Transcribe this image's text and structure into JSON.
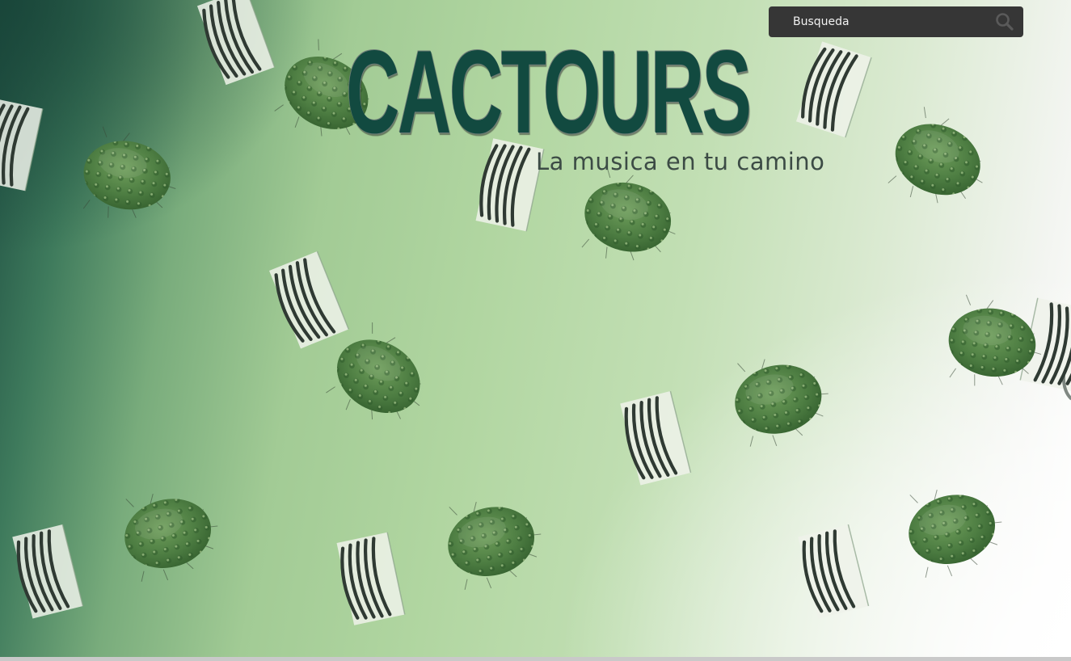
{
  "search": {
    "placeholder": "Busqueda",
    "icon": "search-icon"
  },
  "brand": {
    "title": "CACTOURS",
    "tagline": "La musica en tu camino"
  },
  "colors": {
    "title": "#124a40",
    "search_bg": "#363636",
    "background_dark": "#1f4f42",
    "background_light": "#b1d6a1"
  }
}
